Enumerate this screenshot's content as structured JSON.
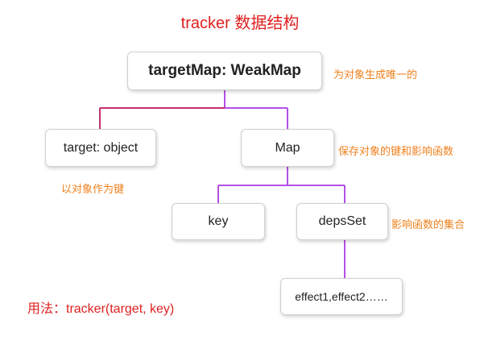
{
  "title": "tracker 数据结构",
  "nodes": {
    "root": "targetMap: WeakMap",
    "target": "target: object",
    "map": "Map",
    "key": "key",
    "deps_set": "depsSet",
    "effects": "effect1,effect2……"
  },
  "notes": {
    "root": "为对象生成唯一的",
    "target": "以对象作为键",
    "map": "保存对象的键和影响函数",
    "deps_set": "影响函数的集合"
  },
  "usage": "用法：tracker(target, key)",
  "colors": {
    "title": "#e02020",
    "note": "#f0801c",
    "connector_left": "#c0306a",
    "connector_right": "#b44fe6"
  }
}
